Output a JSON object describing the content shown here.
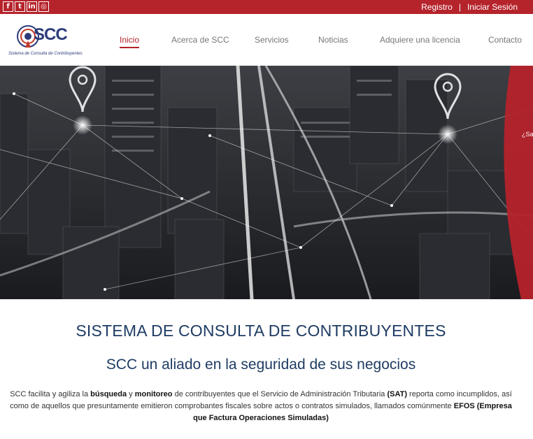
{
  "topbar": {
    "social": [
      {
        "icon": "facebook-icon",
        "glyph": "f"
      },
      {
        "icon": "twitter-icon",
        "glyph": "t"
      },
      {
        "icon": "linkedin-icon",
        "glyph": "in"
      },
      {
        "icon": "instagram-icon",
        "glyph": "◎"
      }
    ],
    "register_label": "Registro",
    "separator": "|",
    "login_label": "Iniciar Sesión"
  },
  "logo": {
    "title": "SCC",
    "subtitle": "Sistema de Consulta de Contribuyentes"
  },
  "nav": {
    "items": [
      {
        "label": "Inicio",
        "active": true
      },
      {
        "label": "Acerca de SCC"
      },
      {
        "label": "Servicios"
      },
      {
        "label": "Noticias"
      },
      {
        "label": "Adquiere una licencia"
      },
      {
        "label": "Contacto"
      }
    ]
  },
  "hero": {
    "side_text": "¿Sa"
  },
  "main": {
    "title": "SISTEMA DE CONSULTA DE CONTRIBUYENTES",
    "subtitle": "SCC un aliado en la seguridad de sus negocios",
    "para": {
      "t1": "SCC facilita y agiliza la ",
      "b1": "búsqueda",
      "t2": " y ",
      "b2": "monitoreo",
      "t3": " de contribuyentes que el Servicio de Administración Tributaria ",
      "b3": "(SAT)",
      "t4": " reporta como incumplidos, así como de aquellos que presuntamente emitieron comprobantes fiscales sobre actos o contratos simulados, llamados comúnmente ",
      "b4": "EFOS (Empresa que Factura Operaciones Simuladas)"
    }
  },
  "colors": {
    "brand_red": "#b5232b",
    "heading_blue": "#1f3c63",
    "logo_blue": "#2b3b7a"
  }
}
